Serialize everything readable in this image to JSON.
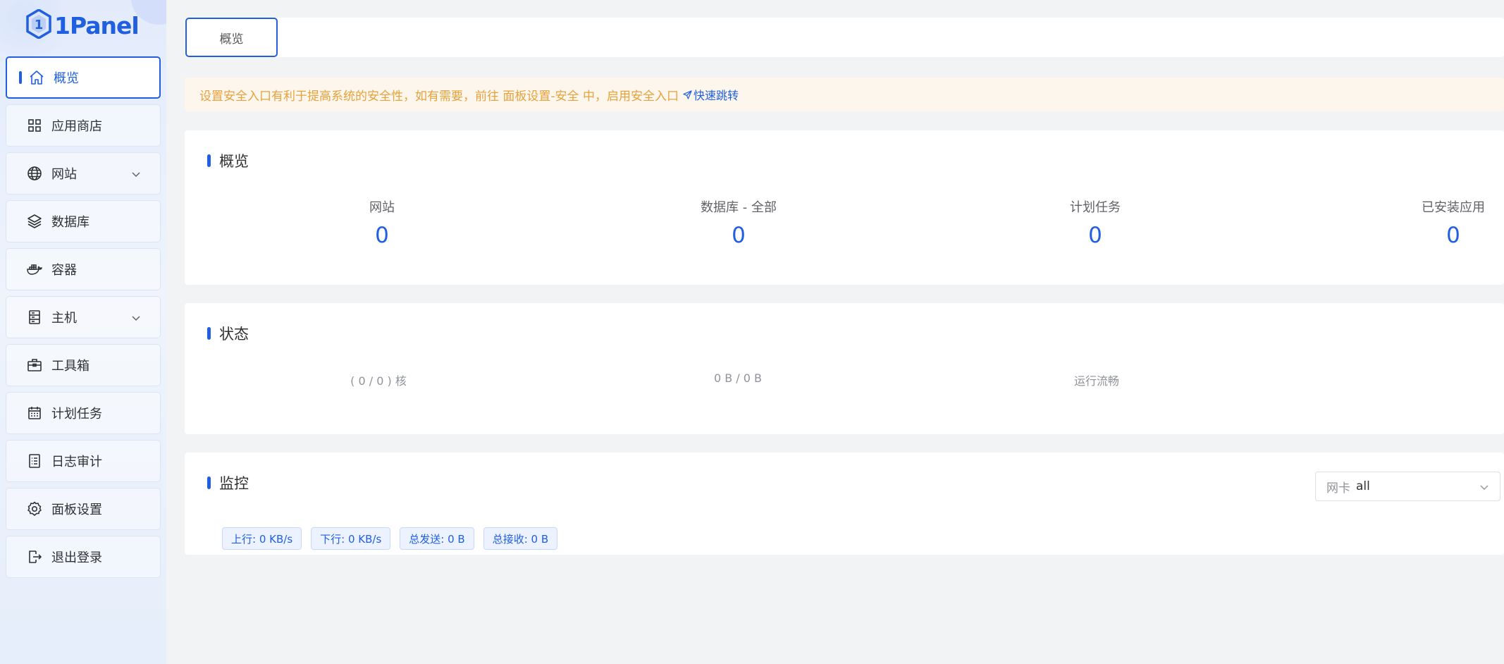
{
  "brand": {
    "name": "1Panel"
  },
  "colors": {
    "accent": "#1f5fe0",
    "warning": "#e6a23c",
    "warning_bg": "#fdf6ec"
  },
  "sidebar": {
    "items": [
      {
        "label": "概览",
        "icon": "home-icon",
        "active": true
      },
      {
        "label": "应用商店",
        "icon": "grid-icon"
      },
      {
        "label": "网站",
        "icon": "globe-icon",
        "expandable": true
      },
      {
        "label": "数据库",
        "icon": "layers-icon"
      },
      {
        "label": "容器",
        "icon": "docker-icon"
      },
      {
        "label": "主机",
        "icon": "server-icon",
        "expandable": true
      },
      {
        "label": "工具箱",
        "icon": "toolbox-icon"
      },
      {
        "label": "计划任务",
        "icon": "calendar-icon"
      },
      {
        "label": "日志审计",
        "icon": "log-icon"
      },
      {
        "label": "面板设置",
        "icon": "gear-icon"
      },
      {
        "label": "退出登录",
        "icon": "logout-icon"
      }
    ]
  },
  "tabs": [
    {
      "label": "概览"
    }
  ],
  "alert": {
    "text": "设置安全入口有利于提高系统的安全性，如有需要，前往 面板设置-安全 中，启用安全入口",
    "link": "快速跳转"
  },
  "overview": {
    "title": "概览",
    "stats": [
      {
        "label": "网站",
        "value": "0"
      },
      {
        "label": "数据库 - 全部",
        "value": "0"
      },
      {
        "label": "计划任务",
        "value": "0"
      },
      {
        "label": "已安装应用",
        "value": "0"
      }
    ]
  },
  "status": {
    "title": "状态",
    "values": [
      "( 0 / 0 ) 核",
      "0 B / 0 B",
      "运行流畅"
    ]
  },
  "monitor": {
    "title": "监控",
    "nic_prefix": "网卡",
    "nic_value": "all",
    "tags": [
      "上行: 0 KB/s",
      "下行: 0 KB/s",
      "总发送: 0 B",
      "总接收: 0 B"
    ]
  }
}
